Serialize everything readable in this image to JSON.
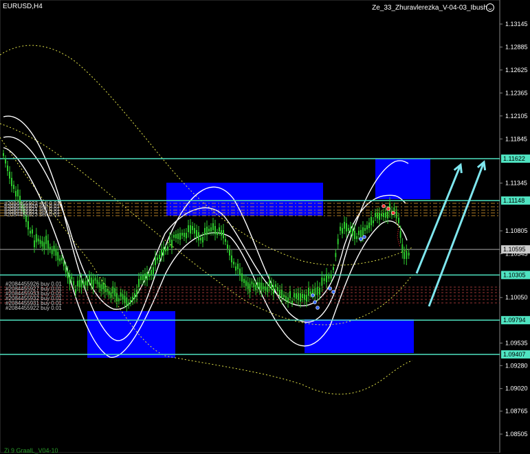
{
  "window": {
    "symbol_label": "EURUSD,H4",
    "indicator_label": "Ze_33_Zhuravlerezka_V-04-03_Ibush",
    "subwindow_label": "Zi 9 GraalL_V04-10",
    "smiley_icon": "smiley-icon"
  },
  "colors": {
    "background": "#000000",
    "candles": "#2ecc2e",
    "bands": "#ffffff",
    "level_lines": "#4fe3c1",
    "zones": "#0000ff",
    "arrows": "#7ee6ee",
    "dotted_ma": "#e6e64a",
    "order_lines": "#e0a030"
  },
  "price_axis": {
    "labels": [
      "1.13145",
      "1.12885",
      "1.12625",
      "1.12365",
      "1.12105",
      "1.11845",
      "1.11345",
      "1.10805",
      "1.10545",
      "1.10050",
      "1.09535",
      "1.09280",
      "1.09020",
      "1.08765",
      "1.08505"
    ],
    "highlighted_levels": [
      {
        "price": "1.11622",
        "bg": "#4fe3c1",
        "fg": "#000000"
      },
      {
        "price": "1.11148",
        "bg": "#4fe3c1",
        "fg": "#000000"
      },
      {
        "price": "1.10595",
        "bg": "#cccccc",
        "fg": "#000000"
      },
      {
        "price": "1.10305",
        "bg": "#4fe3c1",
        "fg": "#000000"
      },
      {
        "price": "1.09794",
        "bg": "#4fe3c1",
        "fg": "#000000"
      },
      {
        "price": "1.09407",
        "bg": "#4fe3c1",
        "fg": "#000000"
      }
    ]
  },
  "order_labels": {
    "upper": [
      "#2084455923 sell 0.01",
      "#2084455920 sell 0.01",
      "#2084455921 sell 0.01",
      "#2084455922 sell 0.01",
      "#2084455923 sell 0.01"
    ],
    "lower": [
      "#2084455926 buy 0.01",
      "#2084455927 buy 0.01",
      "#2084455933 buy 0.01",
      "#2084455932 buy 0.01",
      "#2084455931 buy 0.01",
      "#2084455922 buy 0.01"
    ]
  }
}
